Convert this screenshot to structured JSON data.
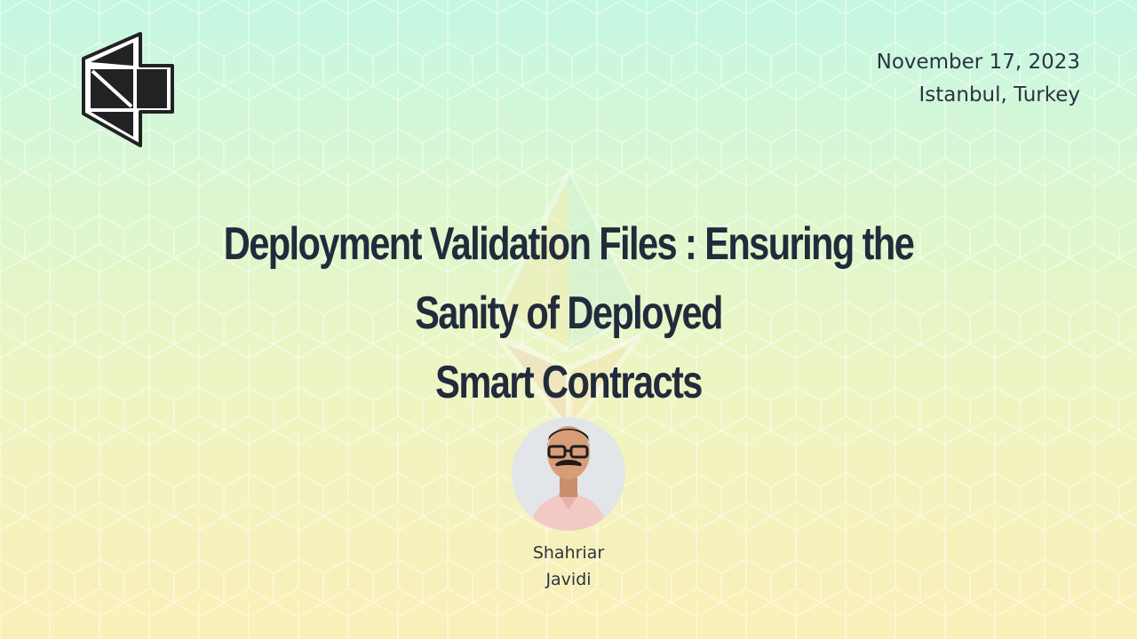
{
  "event": {
    "date": "November 17, 2023",
    "location": "Istanbul, Turkey"
  },
  "talk": {
    "title_line1": "Deployment Validation Files : Ensuring the Sanity of Deployed",
    "title_line2": "Smart Contracts"
  },
  "speaker": {
    "first_name": "Shahriar",
    "last_name": "Javidi"
  },
  "colors": {
    "background_top": "#c4f7e4",
    "background_bottom": "#fbefb8",
    "text": "#222b3b",
    "logo": "#222222"
  },
  "icons": {
    "logo": "devcon-cube-logo",
    "watermark": "ethereum-diamond-icon"
  }
}
